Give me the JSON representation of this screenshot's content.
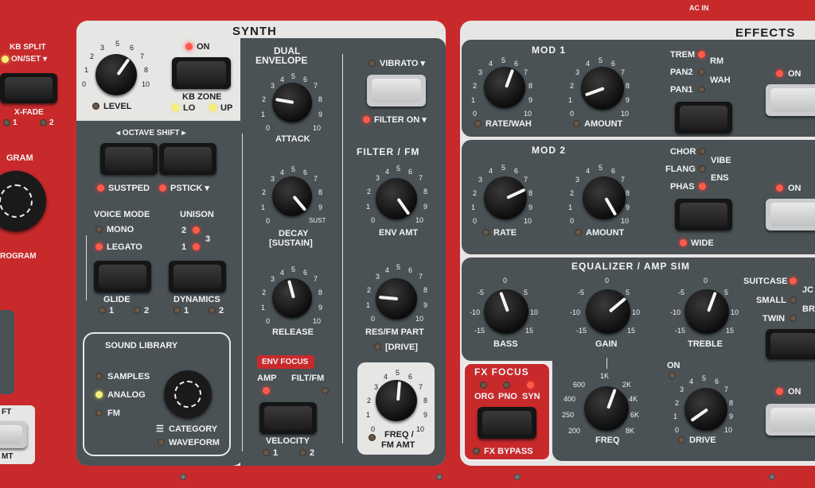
{
  "top": {
    "ac_in": "AC IN"
  },
  "left_strip": {
    "kb_split_line1": "KB SPLIT",
    "kb_split_line2": "ON/SET ▾",
    "x_fade": "X-FADE",
    "xf1": "1",
    "xf2": "2",
    "gram": "GRAM",
    "rogram": "ROGRAM",
    "ft": "FT",
    "mt": "MT"
  },
  "synth": {
    "title": "SYNTH",
    "level_label": "LEVEL",
    "level_ticks": [
      "0",
      "1",
      "2",
      "3",
      "4",
      "5",
      "6",
      "7",
      "8",
      "9",
      "10"
    ],
    "on_label": "ON",
    "kb_zone": "KB ZONE",
    "lo": "LO",
    "up": "UP",
    "octave_shift": "◂ OCTAVE SHIFT ▸",
    "sustped": "SUSTPED",
    "pstick": "PSTICK ▾",
    "voice_mode": "VOICE MODE",
    "mono": "MONO",
    "legato": "LEGATO",
    "unison": "UNISON",
    "u1": "1",
    "u2": "2",
    "u3": "3",
    "glide": "GLIDE",
    "g1": "1",
    "g2": "2",
    "dynamics": "DYNAMICS",
    "d1": "1",
    "d2": "2",
    "sound_library": "SOUND LIBRARY",
    "samples": "SAMPLES",
    "analog": "ANALOG",
    "fm": "FM",
    "category": "CATEGORY",
    "waveform": "WAVEFORM",
    "dual_envelope_1": "DUAL",
    "dual_envelope_2": "ENVELOPE",
    "attack": "ATTACK",
    "decay_1": "DECAY",
    "decay_2": "[SUSTAIN]",
    "sust": "SUST",
    "release": "RELEASE",
    "env_focus": "ENV FOCUS",
    "amp": "AMP",
    "filt_fm": "FILT/FM",
    "velocity": "VELOCITY",
    "v1": "1",
    "v2": "2",
    "vibrato": "VIBRATO ▾",
    "filter_on": "FILTER ON ▾",
    "filter_fm": "FILTER / FM",
    "env_amt": "ENV AMT",
    "res_1": "RES/FM PART",
    "res_2": "[DRIVE]",
    "freq_1": "FREQ /",
    "freq_2": "FM AMT"
  },
  "effects": {
    "title": "EFFECTS",
    "mod1": "MOD 1",
    "rate_wah": "RATE/WAH",
    "amount": "AMOUNT",
    "trem": "TREM",
    "rm": "RM",
    "pan2": "PAN2",
    "wah": "WAH",
    "pan1": "PAN1",
    "on": "ON",
    "mod2": "MOD 2",
    "rate": "RATE",
    "chor": "CHOR",
    "vibe": "VIBE",
    "flang": "FLANG",
    "ens": "ENS",
    "phas": "PHAS",
    "wide": "WIDE",
    "eq_title": "EQUALIZER / AMP SIM",
    "bass": "BASS",
    "gain": "GAIN",
    "treble": "TREBLE",
    "eq_ticks": [
      "-15",
      "-10",
      "-5",
      "0",
      "5",
      "10",
      "15"
    ],
    "suitcase": "SUITCASE",
    "jc": "JC",
    "small": "SMALL",
    "br": "BR",
    "twin": "TWIN",
    "fx_focus": "FX FOCUS",
    "org": "ORG",
    "pno": "PNO",
    "syn": "SYN",
    "fx_bypass": "FX BYPASS",
    "freq": "FREQ",
    "f600": "600",
    "f1k": "1K",
    "f2k": "2K",
    "f400": "400",
    "f4k": "4K",
    "f250": "250",
    "f6k": "6K",
    "f200": "200",
    "f8k": "8K",
    "drive": "DRIVE"
  }
}
